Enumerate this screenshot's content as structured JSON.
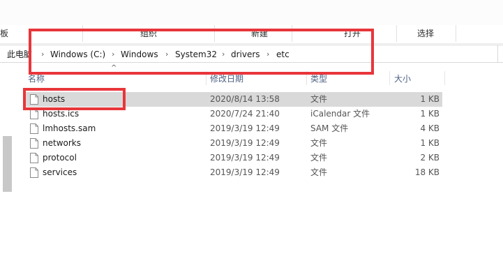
{
  "ribbon": {
    "left_fragment": "板",
    "organize": "组织",
    "new": "新建",
    "open": "打开",
    "select": "选择"
  },
  "address_bar": {
    "crumbs": [
      "此电脑",
      "Windows (C:)",
      "Windows",
      "System32",
      "drivers",
      "etc"
    ]
  },
  "columns": {
    "name": "名称",
    "date_modified": "修改日期",
    "type": "类型",
    "size": "大小"
  },
  "files": [
    {
      "name": "hosts",
      "date": "2020/8/14 13:58",
      "type": "文件",
      "size": "1 KB",
      "selected": true
    },
    {
      "name": "hosts.ics",
      "date": "2020/7/24 21:40",
      "type": "iCalendar 文件",
      "size": "1 KB"
    },
    {
      "name": "lmhosts.sam",
      "date": "2019/3/19 12:49",
      "type": "SAM 文件",
      "size": "4 KB"
    },
    {
      "name": "networks",
      "date": "2019/3/19 12:49",
      "type": "文件",
      "size": "1 KB"
    },
    {
      "name": "protocol",
      "date": "2019/3/19 12:49",
      "type": "文件",
      "size": "2 KB"
    },
    {
      "name": "services",
      "date": "2019/3/19 12:49",
      "type": "文件",
      "size": "18 KB"
    }
  ],
  "colors": {
    "annotation_red": "#e8363b",
    "selected_row": "#d9d9d9",
    "header_text": "#4d6082"
  },
  "icons": {
    "file": "file-icon",
    "chevron": "chevron-right-icon",
    "sort": "chevron-up-icon"
  }
}
